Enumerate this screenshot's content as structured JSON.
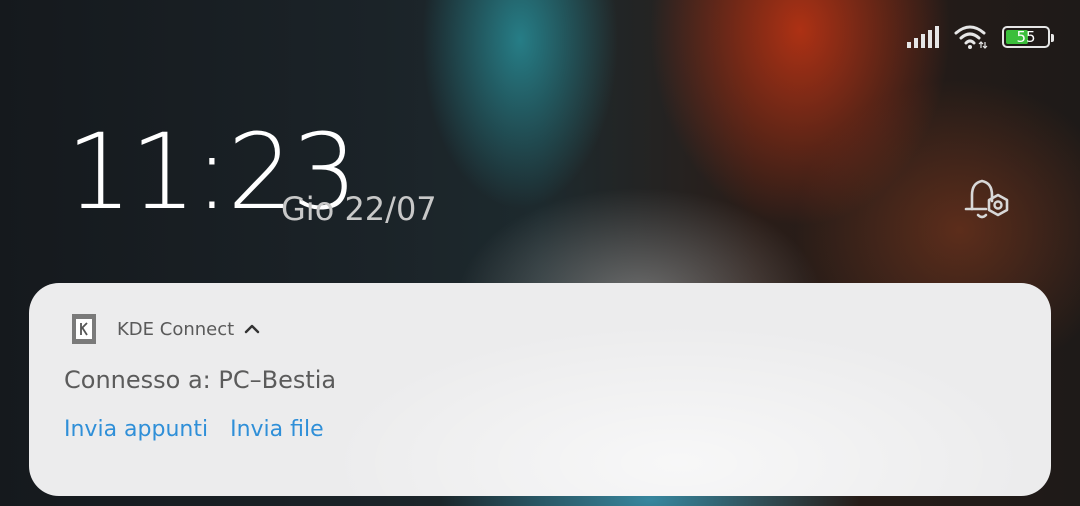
{
  "status_bar": {
    "icons": [
      "signal-icon",
      "wifi-icon",
      "battery-icon"
    ],
    "battery_level": "55",
    "battery_fraction": 0.55,
    "battery_color": "#3bbf3b"
  },
  "lockscreen": {
    "time": "11:23",
    "date": "Gio 22/07",
    "notification_settings_icon": "bell-settings-icon"
  },
  "notification": {
    "app_icon": "kde-connect-icon",
    "app_name": "KDE Connect",
    "text": "Connesso a: PC–Bestia",
    "actions": [
      {
        "label": "Invia appunti"
      },
      {
        "label": "Invia file"
      }
    ],
    "accent_color": "#2f8fd8"
  }
}
